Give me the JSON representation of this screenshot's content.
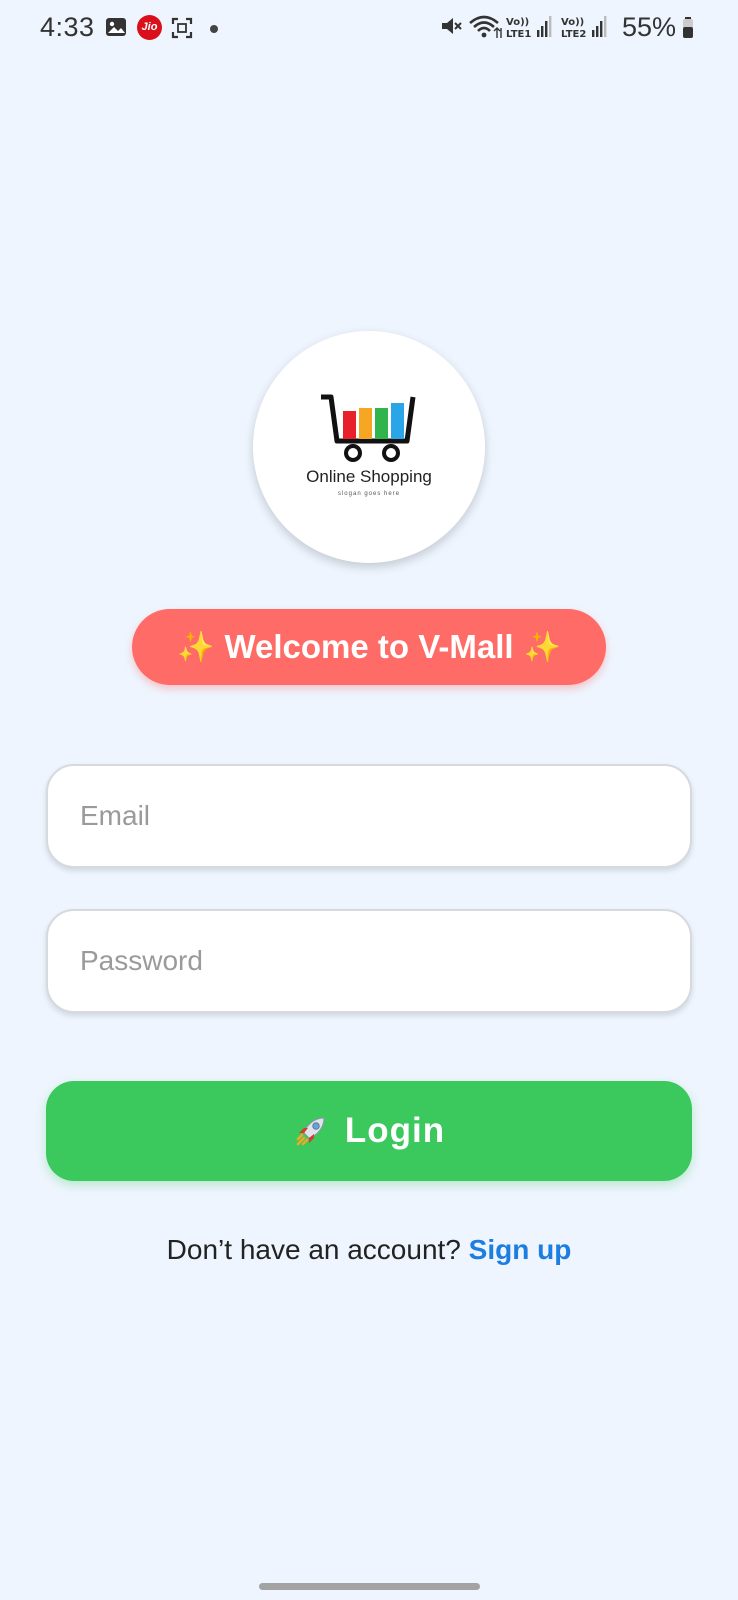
{
  "status_bar": {
    "time": "4:33",
    "carrier_badge": "Jio",
    "battery": "55%",
    "lte1": "LTE1",
    "lte2": "LTE2",
    "volte": "Vo))"
  },
  "logo": {
    "title": "Online Shopping",
    "slogan": "slogan goes here",
    "cart_colors": [
      "#e8202a",
      "#f6a623",
      "#31b44b",
      "#2aa5e8"
    ]
  },
  "welcome": {
    "sparkle": "✨",
    "text": "Welcome to V-Mall"
  },
  "form": {
    "email_placeholder": "Email",
    "email_value": "",
    "password_placeholder": "Password",
    "password_value": "",
    "login_label": "Login"
  },
  "signup": {
    "prompt": "Don’t have an account?",
    "link": "Sign up"
  },
  "colors": {
    "background": "#eef5fe",
    "welcome_bg": "#ff6b66",
    "login_bg": "#3bc95e",
    "link": "#1c7ee0"
  },
  "icons": [
    "gallery-icon",
    "jio-icon",
    "screen-scan-icon",
    "mute-icon",
    "wifi-icon",
    "signal-icon",
    "battery-icon",
    "rocket-icon",
    "shopping-cart-icon"
  ]
}
